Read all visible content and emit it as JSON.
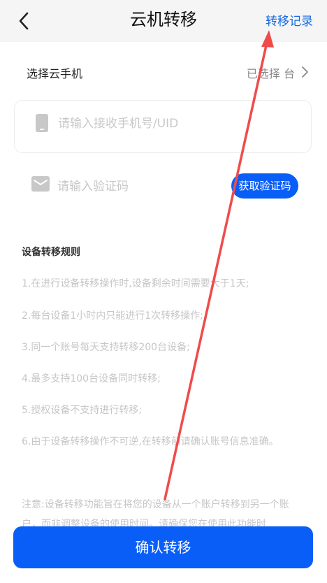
{
  "header": {
    "title": "云机转移",
    "record_link": "转移记录",
    "back_icon": "chevron-left-icon"
  },
  "select_row": {
    "label": "选择云手机",
    "value": "已选择    台",
    "chevron_icon": "chevron-right-icon"
  },
  "phone_field": {
    "placeholder": "请输入接收手机号/UID",
    "icon": "phone-icon"
  },
  "code_field": {
    "placeholder": "请输入验证码",
    "icon": "mail-icon",
    "button_label": "获取验证码"
  },
  "rules": {
    "title": "设备转移规则",
    "items": [
      "1.在进行设备转移操作时,设备剩余时间需要大于1天;",
      "2.每台设备1小时内只能进行1次转移操作;",
      "3.同一个账号每天支持转移200台设备;",
      "4.最多支持100台设备同时转移;",
      "5.授权设备不支持进行转移;",
      "6.由于设备转移操作不可逆,在转移前请确认账号信息准确。"
    ],
    "note": "注意:设备转移功能旨在将您的设备从一个账户转移到另一个账户，而非调整设备的使用时间。请确保您在使用此功能时"
  },
  "confirm_button": {
    "label": "确认转移"
  },
  "colors": {
    "accent": "#0a5ef8",
    "link": "#1769e0",
    "annotation_arrow": "#f04b4b"
  }
}
